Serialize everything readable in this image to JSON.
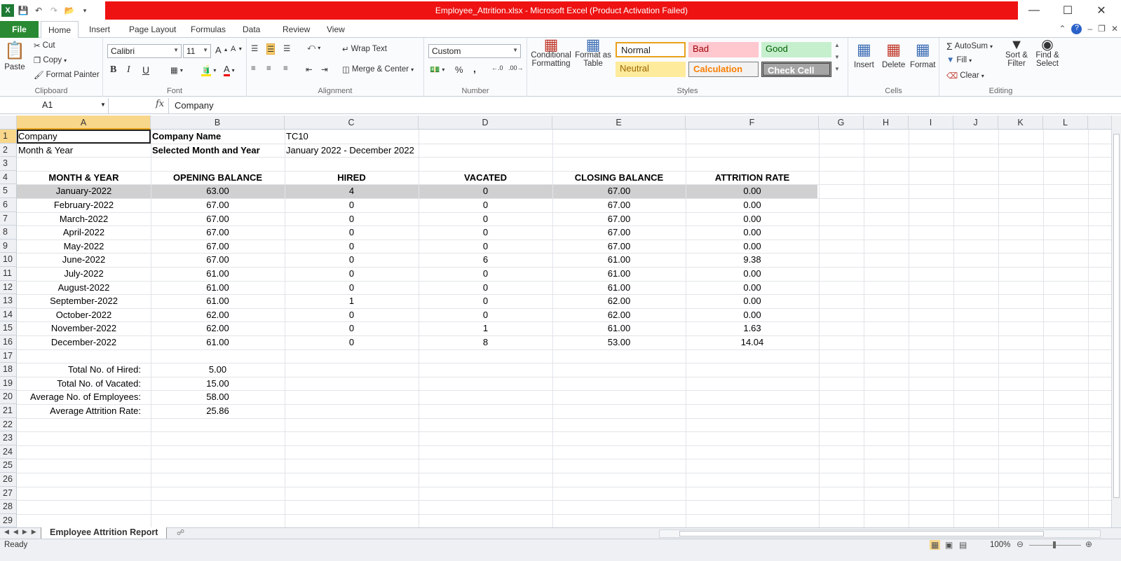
{
  "window": {
    "title": "Employee_Attrition.xlsx  -  Microsoft Excel (Product Activation Failed)"
  },
  "ribbon": {
    "tabs": [
      "File",
      "Home",
      "Insert",
      "Page Layout",
      "Formulas",
      "Data",
      "Review",
      "View"
    ],
    "clipboard": {
      "paste": "Paste",
      "cut": "Cut",
      "copy": "Copy",
      "format_painter": "Format Painter",
      "label": "Clipboard"
    },
    "font": {
      "name": "Calibri",
      "size": "11",
      "label": "Font",
      "bold": "B",
      "italic": "I",
      "underline": "U"
    },
    "alignment": {
      "wrap_text": "Wrap Text",
      "merge_center": "Merge & Center",
      "label": "Alignment"
    },
    "number": {
      "format": "Custom",
      "percent": "%",
      "comma": ",",
      "label": "Number"
    },
    "styles": {
      "conditional_formatting": "Conditional Formatting",
      "format_as_table": "Format as Table",
      "normal": "Normal",
      "bad": "Bad",
      "good": "Good",
      "neutral": "Neutral",
      "calculation": "Calculation",
      "check_cell": "Check Cell",
      "label": "Styles"
    },
    "cells": {
      "insert": "Insert",
      "delete": "Delete",
      "format": "Format",
      "label": "Cells"
    },
    "editing": {
      "autosum": "AutoSum",
      "fill": "Fill",
      "clear": "Clear",
      "sort_filter": "Sort & Filter",
      "find_select": "Find & Select",
      "label": "Editing"
    }
  },
  "formula_bar": {
    "name_box": "A1",
    "fx": "fx",
    "content": "Company"
  },
  "columns": [
    "A",
    "B",
    "C",
    "D",
    "E",
    "F",
    "G",
    "H",
    "I",
    "J",
    "K",
    "L"
  ],
  "rows": [
    "1",
    "2",
    "3",
    "4",
    "5",
    "6",
    "7",
    "8",
    "9",
    "10",
    "11",
    "12",
    "13",
    "14",
    "15",
    "16",
    "17",
    "18",
    "19",
    "20",
    "21",
    "22",
    "23",
    "24",
    "25",
    "26",
    "27",
    "28",
    "29"
  ],
  "sheet": {
    "info": [
      {
        "label": "Company",
        "key": "Company Name",
        "value": "TC10"
      },
      {
        "label": "Month & Year",
        "key": "Selected Month and Year",
        "value": "January 2022 - December 2022"
      }
    ],
    "table_headers": [
      "MONTH & YEAR",
      "OPENING BALANCE",
      "HIRED",
      "VACATED",
      "CLOSING BALANCE",
      "ATTRITION RATE"
    ],
    "table_rows": [
      [
        "January-2022",
        "63.00",
        "4",
        "0",
        "67.00",
        "0.00"
      ],
      [
        "February-2022",
        "67.00",
        "0",
        "0",
        "67.00",
        "0.00"
      ],
      [
        "March-2022",
        "67.00",
        "0",
        "0",
        "67.00",
        "0.00"
      ],
      [
        "April-2022",
        "67.00",
        "0",
        "0",
        "67.00",
        "0.00"
      ],
      [
        "May-2022",
        "67.00",
        "0",
        "0",
        "67.00",
        "0.00"
      ],
      [
        "June-2022",
        "67.00",
        "0",
        "6",
        "61.00",
        "9.38"
      ],
      [
        "July-2022",
        "61.00",
        "0",
        "0",
        "61.00",
        "0.00"
      ],
      [
        "August-2022",
        "61.00",
        "0",
        "0",
        "61.00",
        "0.00"
      ],
      [
        "September-2022",
        "61.00",
        "1",
        "0",
        "62.00",
        "0.00"
      ],
      [
        "October-2022",
        "62.00",
        "0",
        "0",
        "62.00",
        "0.00"
      ],
      [
        "November-2022",
        "62.00",
        "0",
        "1",
        "61.00",
        "1.63"
      ],
      [
        "December-2022",
        "61.00",
        "0",
        "8",
        "53.00",
        "14.04"
      ]
    ],
    "summary": [
      {
        "label": "Total No. of Hired:",
        "value": "5.00"
      },
      {
        "label": "Total No. of Vacated:",
        "value": "15.00"
      },
      {
        "label": "Average No. of Employees:",
        "value": "58.00"
      },
      {
        "label": "Average Attrition Rate:",
        "value": "25.86"
      }
    ]
  },
  "sheet_tabs": [
    "Employee Attrition Report"
  ],
  "status": {
    "ready": "Ready",
    "zoom": "100%"
  }
}
